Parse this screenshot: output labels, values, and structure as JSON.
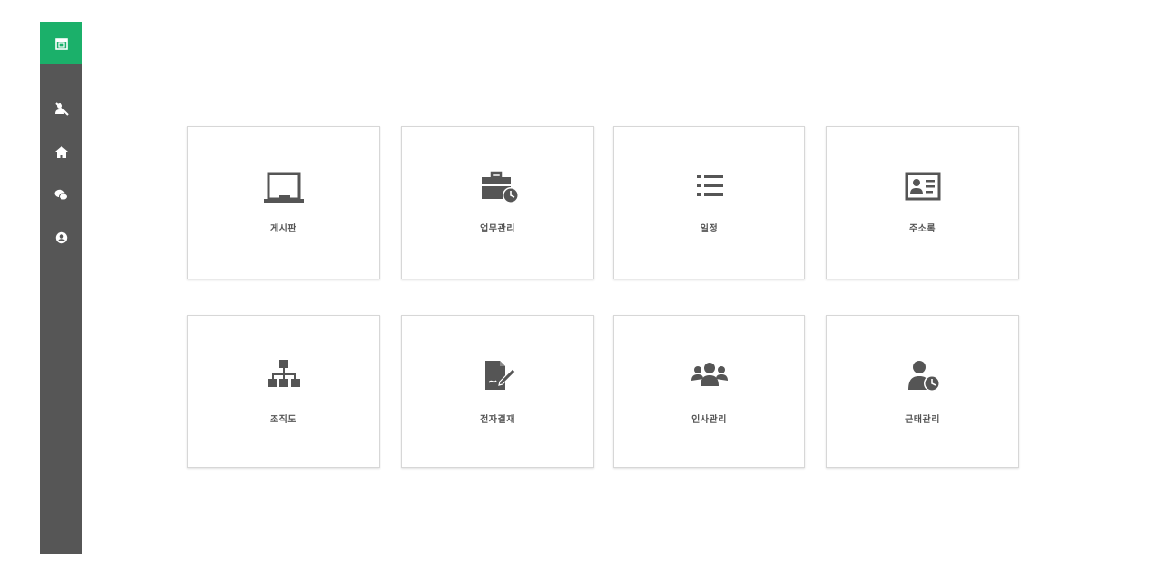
{
  "sidebar": {
    "logo_icon": "calendar-logo-icon",
    "accent_color": "#1bb06a",
    "background_color": "#565656",
    "items": [
      {
        "icon": "user-slash-icon"
      },
      {
        "icon": "home-icon"
      },
      {
        "icon": "chat-bubbles-icon"
      },
      {
        "icon": "user-circle-icon"
      }
    ]
  },
  "menu": {
    "tiles": [
      {
        "label": "게시판",
        "icon": "board-screen-icon"
      },
      {
        "label": "업무관리",
        "icon": "briefcase-clock-icon"
      },
      {
        "label": "일정",
        "icon": "list-icon"
      },
      {
        "label": "주소록",
        "icon": "contact-card-icon"
      },
      {
        "label": "조직도",
        "icon": "org-chart-icon"
      },
      {
        "label": "전자결재",
        "icon": "document-sign-icon"
      },
      {
        "label": "인사관리",
        "icon": "users-group-icon"
      },
      {
        "label": "근태관리",
        "icon": "user-clock-icon"
      }
    ]
  }
}
